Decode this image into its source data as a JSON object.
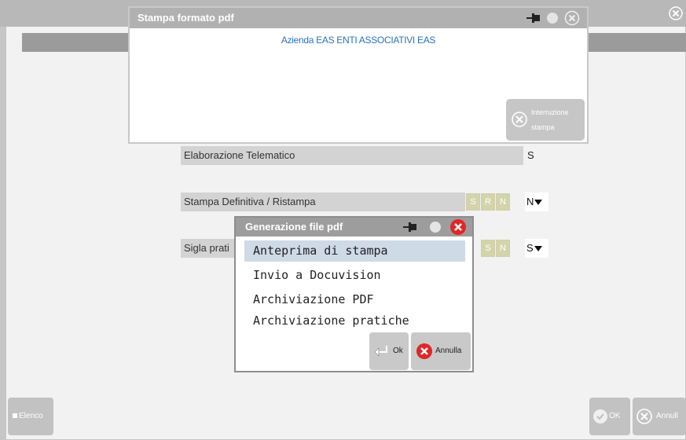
{
  "print_window": {
    "title": "Stampa formato pdf",
    "company_line": "Azienda EAS ENTI ASSOCIATIVI EAS",
    "interrupt_line1": "Interruzione",
    "interrupt_line2": "stampa"
  },
  "form": {
    "elaborazione_label": "Elaborazione Telematico",
    "elaborazione_value": "S",
    "stampa_definitiva_label": "Stampa Definitiva / Ristampa",
    "stampa_definitiva_options": [
      "S",
      "R",
      "N"
    ],
    "stampa_definitiva_value": "N",
    "sigla_label": "Sigla prati",
    "sigla_options": [
      "S",
      "N"
    ],
    "sigla_value": "S"
  },
  "footer": {
    "elenco_label": "Elenco",
    "ok_label": "OK",
    "annulla_label": "Annull"
  },
  "generation_dialog": {
    "title": "Generazione file pdf",
    "items": [
      "Anteprima di stampa",
      "Invio a Docuvision",
      "Archiviazione PDF",
      "Archiviazione pratiche"
    ],
    "selected_index": 0,
    "ok_label": "Ok",
    "annulla_label": "Annulla"
  },
  "colors": {
    "company_text": "#2a73c2",
    "close_red": "#e02727",
    "selection": "#cfdae7"
  }
}
